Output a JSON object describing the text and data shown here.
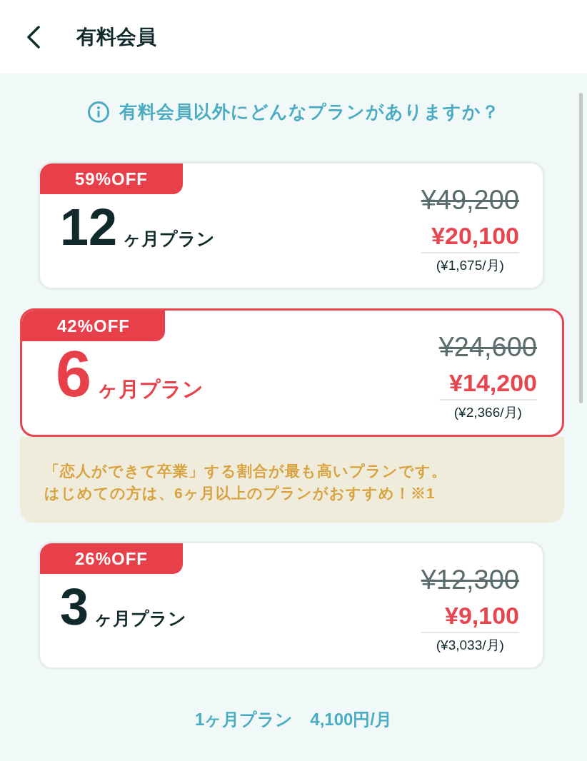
{
  "header": {
    "title": "有料会員"
  },
  "info_link": {
    "text": "有料会員以外にどんなプランがありますか？"
  },
  "plans": [
    {
      "badge": "59%OFF",
      "months": "12",
      "unit": "ヶ月プラン",
      "original_price": "¥49,200",
      "price": "¥20,100",
      "monthly": "(¥1,675/月)",
      "selected": false
    },
    {
      "badge": "42%OFF",
      "months": "6",
      "unit": "ヶ月プラン",
      "original_price": "¥24,600",
      "price": "¥14,200",
      "monthly": "(¥2,366/月)",
      "selected": true,
      "note": [
        "「恋人ができて卒業」する割合が最も高いプランです。",
        "はじめての方は、6ヶ月以上のプランがおすすめ！※1"
      ]
    },
    {
      "badge": "26%OFF",
      "months": "3",
      "unit": "ヶ月プラン",
      "original_price": "¥12,300",
      "price": "¥9,100",
      "monthly": "(¥3,033/月)",
      "selected": false
    }
  ],
  "monthly_plan_link": {
    "text": "1ヶ月プラン　4,100円/月"
  }
}
